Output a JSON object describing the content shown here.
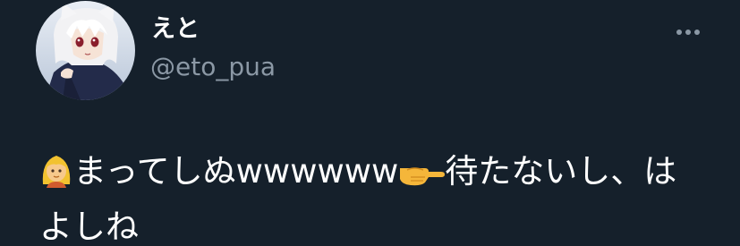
{
  "user": {
    "display_name": "えと",
    "handle": "@eto_pua",
    "avatar_icon": "anime-character-avatar"
  },
  "menu": {
    "icon": "more-horizontal-icon"
  },
  "tweet": {
    "emoji_1": "woman-blonde-emoji",
    "text_1": "まってしぬwwwwww",
    "emoji_2": "backhand-index-pointing-right-emoji",
    "text_2": "待たないし、はよしね"
  },
  "colors": {
    "background": "#15202b",
    "primary_text": "#ffffff",
    "secondary_text": "#8b98a5"
  }
}
